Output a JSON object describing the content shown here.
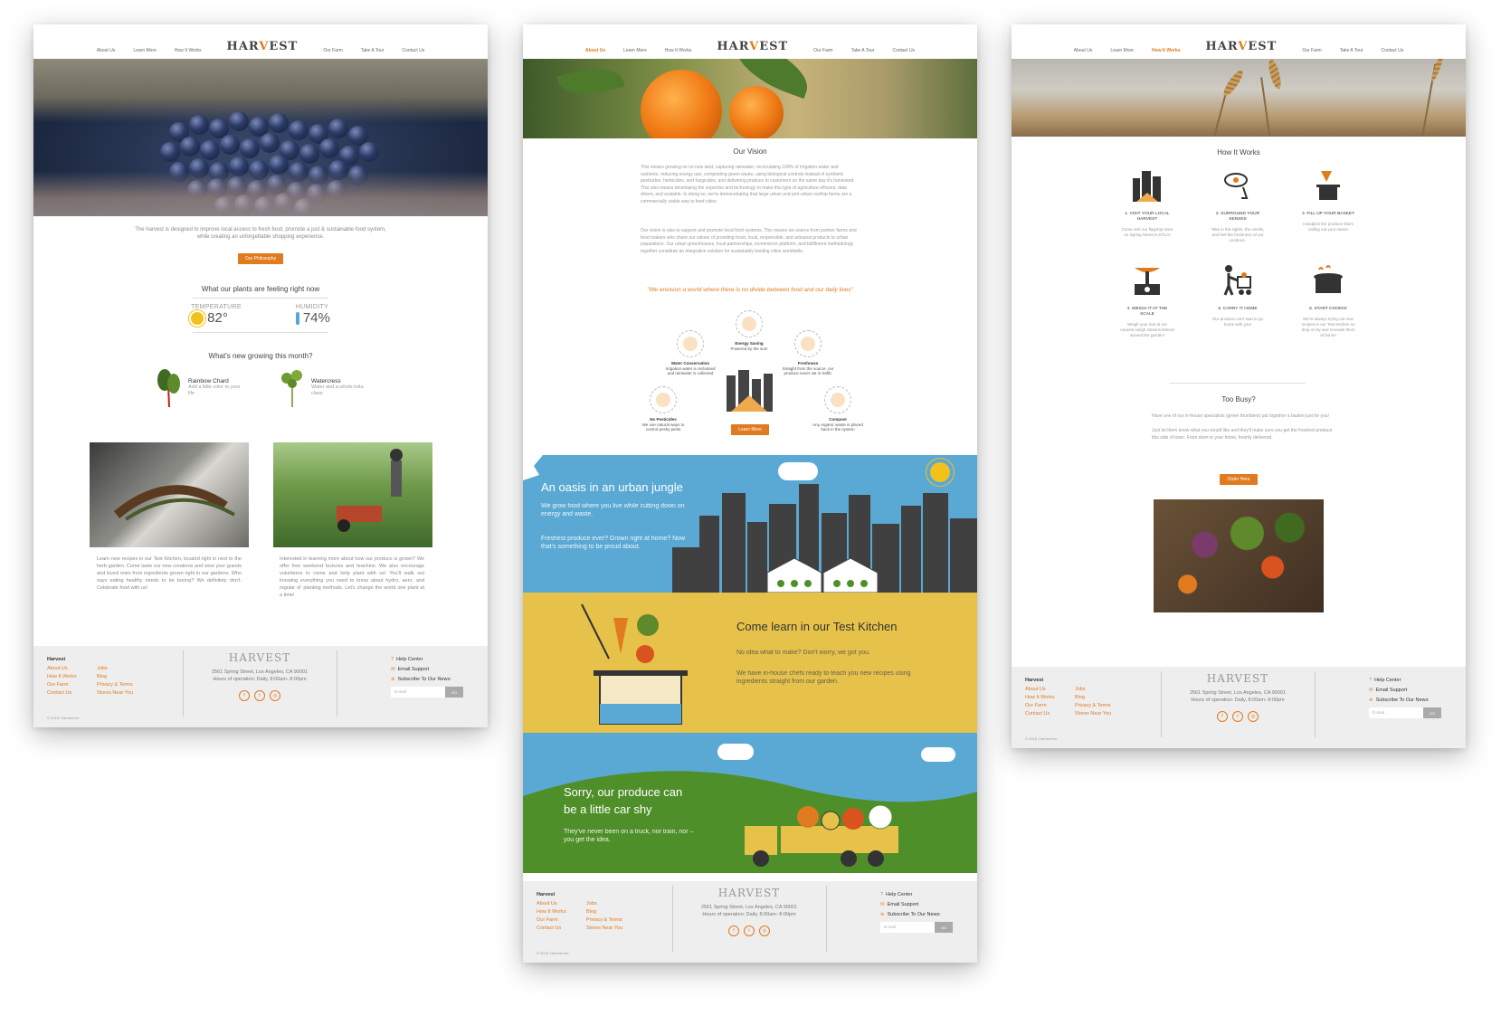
{
  "colors": {
    "accent": "#e07b1f",
    "footer_bg": "#eeeeee",
    "sky": "#5aa9d4",
    "mustard": "#e6c24a",
    "grass": "#4f8f2a"
  },
  "nav": {
    "items": [
      "About Us",
      "Learn More",
      "How It Works",
      "Our Farm",
      "Take A Tour",
      "Contact Us"
    ],
    "logo": "HARVEST"
  },
  "home": {
    "intro": "The harvest is designed to improve local access to fresh food, promote a just & sustainable food system, while creating an unforgettable shopping experience.",
    "philosophy_btn": "Our Philosophy",
    "plants_title": "What our plants are feeling right now",
    "temp_label": "TEMPERATURE",
    "temp_value": "82°",
    "humidity_label": "HUMIDITY",
    "humidity_value": "74%",
    "growing_title": "What's new growing this month?",
    "plant1_name": "Rainbow Chard",
    "plant1_desc": "Add a little color to your life",
    "plant2_name": "Watercress",
    "plant2_desc": "Water and a whole lotta class",
    "col1_text": "Learn new recipes in our Test Kitchen, located right in next to the herb garden. Come taste our new creations and wow your guests and loved ones from ingredients grown right in our gardens. Who says eating healthy needs to be boring? We definitely don't. Celebrate food with us!",
    "col2_text": "Interested in learning more about how our produce is grown? We offer free weekend lectures and teachins. We also encourage volunteers to come and help plant with us! You'll walk out knowing everything you need to know about hydro, aero, and regular ol' planting methods. Let's change the world one plant at a time!"
  },
  "about": {
    "vision_title": "Our Vision",
    "vision_p1": "This means growing on no new land, capturing rainwater, recirculating 100% of irrigation water and nutrients, reducing energy use, composting green waste, using biological controls instead of synthetic pesticides, herbicides, and fungicides, and delivering produce to customers on the same day it's harvested. This also means developing the expertise and technology to make this type of agriculture efficient, data driven, and scalable. In doing so, we're demonstrating that large urban and peri-urban rooftop farms are a commercially viable way to feed cities.",
    "vision_p2": "Our vision is also to support and promote local food systems. This means we source from partner farms and food makers who share our values of providing fresh, local, responsible, and artisanal products to urban populations. Our urban greenhouses, local partnerships, ecommerce platform, and fulfillment methodology together constitute an integrative solution for sustainably feeding cities worldwide.",
    "quote": "\"We envision a world where there is no divide between food and our daily lives\"",
    "f_energy_t": "Energy Saving",
    "f_energy_s": "Powered by the sun!",
    "f_water_t": "Water Conservation",
    "f_water_s": "Irrigation water is reclaimed and rainwater is collected",
    "f_fresh_t": "Freshness",
    "f_fresh_s": "Straight from the source, our produce never sat in traffic",
    "f_pest_t": "No Pesticides",
    "f_pest_s": "We use natural ways to control pesky pests",
    "f_comp_t": "Compost",
    "f_comp_s": "Any organic waste is placed back in the system",
    "learn_btn": "Learn More",
    "oasis_title": "An oasis in an urban jungle",
    "oasis_p1": "We grow food where you live while cutting down on energy and waste.",
    "oasis_p2": "Freshest produce ever? Grown right at home? Now that's something to be proud about.",
    "kitchen_title": "Come learn in our Test Kitchen",
    "kitchen_p1": "No idea what to make? Don't worry, we got you.",
    "kitchen_p2": "We have in-house chefs ready to teach you new recipes using ingredients straight from our garden.",
    "car_title1": "Sorry, our produce can",
    "car_title2": "be a little car shy",
    "car_text": "They've never been on a truck, nor train, nor – you get the idea."
  },
  "how": {
    "title": "How It Works",
    "s1_t": "1. VISIT YOUR LOCAL HARVEST",
    "s1_s": "Come visit our flagship store on Spring Street in DTLA!",
    "s2_t": "2. SURROUND YOUR SENSES",
    "s2_s": "Take in the sights, the smells, and feel the freshness of our produce.",
    "s3_t": "3. FILL UP YOUR BASKET",
    "s3_s": "Handpick the produce that's calling out your name!",
    "s4_t": "4. WEIGH IT AT THE SCALE",
    "s4_s": "Weigh your loot at our nearest weigh stations littered around the garden!",
    "s5_t": "5. CARRY IT HOME",
    "s5_s": "Our produce can't wait to go home with you!",
    "s6_t": "6. START COOKIN'",
    "s6_s": "We're always trying out new recipes in our Test Kitchen so drop on by and recreate them at home!",
    "busy_title": "Too Busy?",
    "busy_p1": "Have one of our in-house specialists (green thumbers) put together a basket just for you!",
    "busy_p2": "Just let them know what you would like and they'll make sure you get the freshest produce this side of town. From stem to your home, freshly delivered.",
    "order_btn": "Order Here"
  },
  "footer": {
    "brand": "Harvest",
    "links": [
      "About Us",
      "Jobs",
      "How It Works",
      "Blog",
      "Our Farm",
      "Privacy & Terms",
      "Contact Us",
      "Stores Near You"
    ],
    "logo": "HARVEST",
    "address": "2561 Spring Street, Los Angeles, CA 90001",
    "hours": "Hours of operation: Daily, 8:00am- 8:00pm",
    "help": "Help Center",
    "email": "Email Support",
    "subscribe": "Subscribe To Our News:",
    "placeholder": "E-mail",
    "go": "GO",
    "copyright": "© 2015, Harvest Inc."
  }
}
